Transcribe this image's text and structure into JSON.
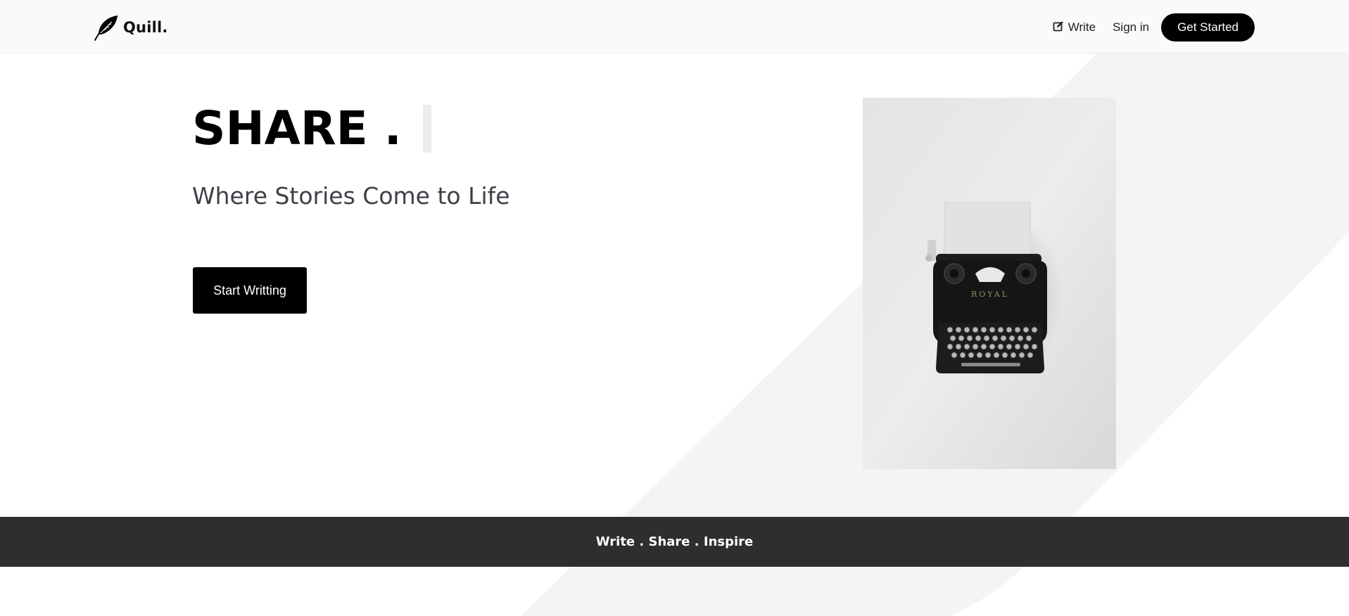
{
  "brand": {
    "name": "Quill.",
    "logo_icon": "feather-icon"
  },
  "nav": {
    "write_icon": "edit-icon",
    "write_label": "Write",
    "signin_label": "Sign in",
    "get_started_label": "Get Started"
  },
  "hero": {
    "title": "SHARE .",
    "subtitle": "Where Stories Come to Life",
    "cta_label": "Start Writting",
    "image_icon": "typewriter-image",
    "image_brand_text": "ROYAL"
  },
  "band": {
    "tagline": "Write . Share . Inspire"
  },
  "colors": {
    "primary": "#000000",
    "band_bg": "#2e2e2e",
    "subtitle": "#3d4147",
    "navbar_bg": "#fafafa",
    "diagonal_band": "#f4f4f4"
  }
}
